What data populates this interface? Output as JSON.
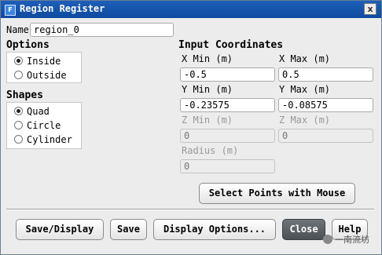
{
  "window": {
    "title": "Region Register",
    "close_glyph": "x",
    "app_icon_glyph": "F"
  },
  "name": {
    "label": "Name",
    "value": "region_0"
  },
  "options": {
    "title": "Options",
    "items": [
      {
        "label": "Inside",
        "checked": true
      },
      {
        "label": "Outside",
        "checked": false
      }
    ]
  },
  "shapes": {
    "title": "Shapes",
    "items": [
      {
        "label": "Quad",
        "checked": true
      },
      {
        "label": "Circle",
        "checked": false
      },
      {
        "label": "Cylinder",
        "checked": false
      }
    ]
  },
  "coords": {
    "title": "Input Coordinates",
    "x_min_label": "X Min (m)",
    "x_min_value": "-0.5",
    "x_max_label": "X Max (m)",
    "x_max_value": "0.5",
    "y_min_label": "Y Min (m)",
    "y_min_value": "-0.23575",
    "y_max_label": "Y Max (m)",
    "y_max_value": "-0.08575",
    "z_min_label": "Z Min (m)",
    "z_min_value": "0",
    "z_max_label": "Z Max (m)",
    "z_max_value": "0",
    "radius_label": "Radius (m)",
    "radius_value": "0"
  },
  "buttons": {
    "select_points": "Select Points with Mouse",
    "save_display": "Save/Display",
    "save": "Save",
    "display_options": "Display Options...",
    "close": "Close",
    "help": "Help"
  },
  "watermark": {
    "text": "一南流坊"
  }
}
